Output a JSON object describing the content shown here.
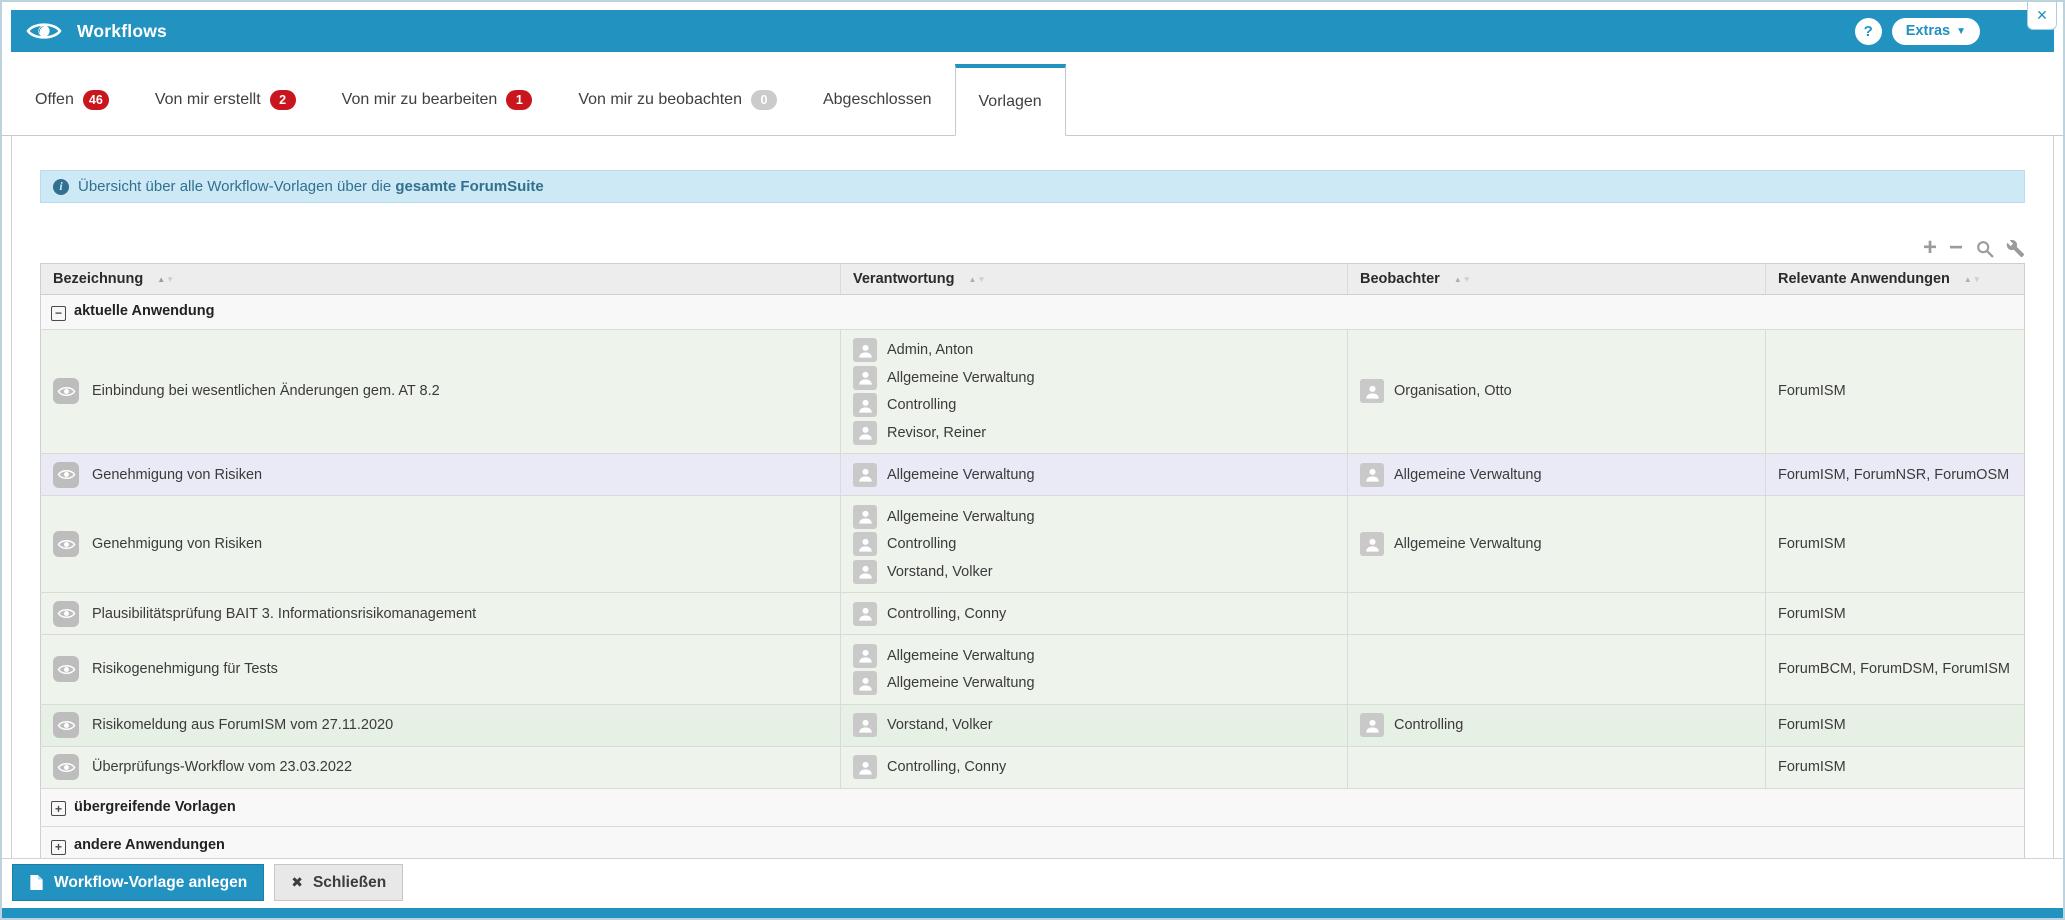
{
  "window": {
    "title": "Workflows",
    "help_label": "?",
    "extras_label": "Extras",
    "close_label": "✕"
  },
  "tabs": [
    {
      "label": "Offen",
      "badge": "46",
      "badge_color": "red",
      "active": false
    },
    {
      "label": "Von mir erstellt",
      "badge": "2",
      "badge_color": "red",
      "active": false
    },
    {
      "label": "Von mir zu bearbeiten",
      "badge": "1",
      "badge_color": "red",
      "active": false
    },
    {
      "label": "Von mir zu beobachten",
      "badge": "0",
      "badge_color": "gray",
      "active": false
    },
    {
      "label": "Abgeschlossen",
      "badge": null,
      "active": false
    },
    {
      "label": "Vorlagen",
      "badge": null,
      "active": true
    }
  ],
  "info_banner": {
    "prefix": "Übersicht über alle Workflow-Vorlagen über die",
    "bold": "gesamte ForumSuite"
  },
  "toolbar": {
    "icons": [
      "plus",
      "minus",
      "search",
      "wrench"
    ]
  },
  "table": {
    "columns": [
      {
        "label": "Bezeichnung",
        "sorted": "asc"
      },
      {
        "label": "Verantwortung",
        "sorted": null
      },
      {
        "label": "Beobachter",
        "sorted": null
      },
      {
        "label": "Relevante Anwendungen",
        "sorted": null
      }
    ],
    "groups": [
      {
        "label": "aktuelle Anwendung",
        "expanded": true,
        "rows": [
          {
            "name": "Einbindung bei wesentlichen Änderungen gem. AT 8.2",
            "responsible": [
              "Admin, Anton",
              "Allgemeine Verwaltung",
              "Controlling",
              "Revisor, Reiner"
            ],
            "observers": [
              "Organisation, Otto"
            ],
            "apps": "ForumISM",
            "highlight": false,
            "shade": ""
          },
          {
            "name": "Genehmigung von Risiken",
            "responsible": [
              "Allgemeine Verwaltung"
            ],
            "observers": [
              "Allgemeine Verwaltung"
            ],
            "apps": "ForumISM, ForumNSR, ForumOSM",
            "highlight": true,
            "shade": ""
          },
          {
            "name": "Genehmigung von Risiken",
            "responsible": [
              "Allgemeine Verwaltung",
              "Controlling",
              "Vorstand, Volker"
            ],
            "observers": [
              "Allgemeine Verwaltung"
            ],
            "apps": "ForumISM",
            "highlight": false,
            "shade": ""
          },
          {
            "name": "Plausibilitätsprüfung BAIT 3. Informationsrisikomanagement",
            "responsible": [
              "Controlling, Conny"
            ],
            "observers": [],
            "apps": "ForumISM",
            "highlight": false,
            "shade": ""
          },
          {
            "name": "Risikogenehmigung für Tests",
            "responsible": [
              "Allgemeine Verwaltung",
              "Allgemeine Verwaltung"
            ],
            "observers": [],
            "apps": "ForumBCM, ForumDSM, ForumISM",
            "highlight": false,
            "shade": ""
          },
          {
            "name": "Risikomeldung aus ForumISM vom 27.11.2020",
            "responsible": [
              "Vorstand, Volker"
            ],
            "observers": [
              "Controlling"
            ],
            "apps": "ForumISM",
            "highlight": false,
            "shade": "dark"
          },
          {
            "name": "Überprüfungs-Workflow vom 23.03.2022",
            "responsible": [
              "Controlling, Conny"
            ],
            "observers": [],
            "apps": "ForumISM",
            "highlight": false,
            "shade": ""
          }
        ]
      },
      {
        "label": "übergreifende Vorlagen",
        "expanded": false,
        "rows": []
      },
      {
        "label": "andere Anwendungen",
        "expanded": false,
        "rows": []
      }
    ]
  },
  "footer": {
    "create_label": "Workflow-Vorlage anlegen",
    "close_label": "Schließen"
  },
  "colors": {
    "accent": "#2292c1",
    "badge_red": "#c9151d",
    "badge_gray": "#cbcbcb",
    "banner_bg": "#cee9f6",
    "banner_text": "#31708f",
    "row_green": "#eef3ec",
    "row_highlight": "#e9eaf6",
    "header_gray": "#ededed"
  }
}
